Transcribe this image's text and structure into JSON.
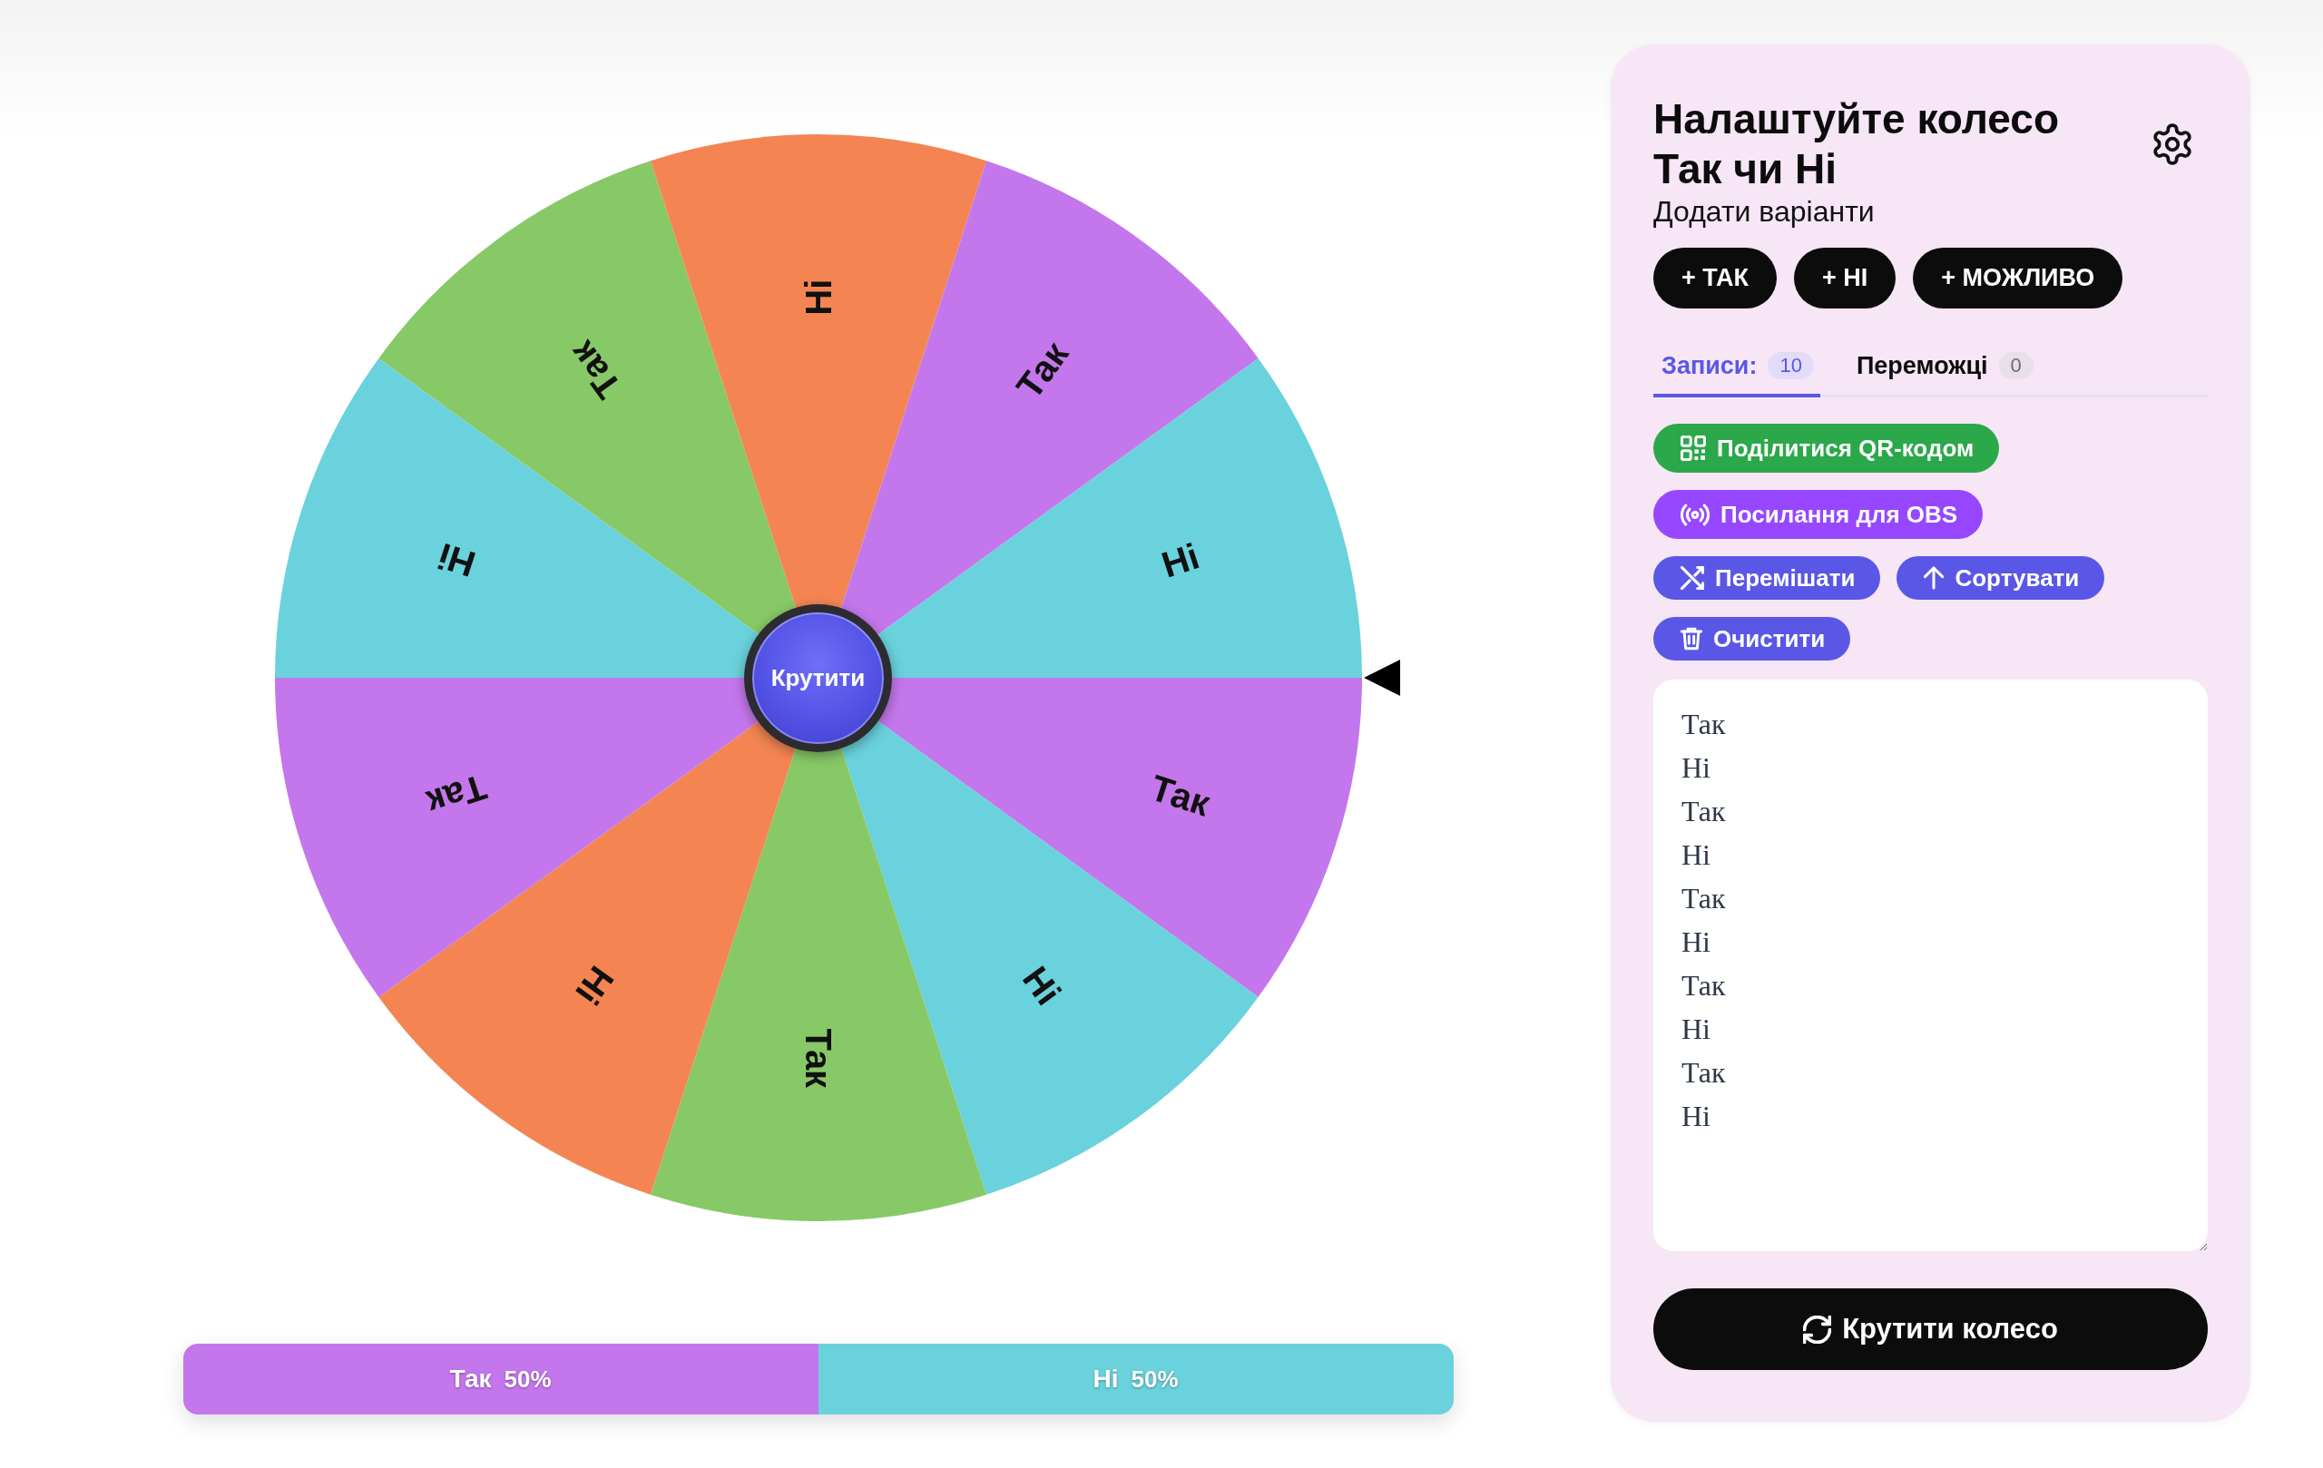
{
  "wheel": {
    "segments": [
      {
        "label": "Так",
        "color": "#c477ec"
      },
      {
        "label": "Ні",
        "color": "#6ad2dc"
      },
      {
        "label": "Так",
        "color": "#88c967"
      },
      {
        "label": "Ні",
        "color": "#f48553"
      },
      {
        "label": "Так",
        "color": "#c477ec"
      },
      {
        "label": "Ні",
        "color": "#6ad2dc"
      },
      {
        "label": "Так",
        "color": "#88c967"
      },
      {
        "label": "Ні",
        "color": "#f48553"
      },
      {
        "label": "Так",
        "color": "#c477ec"
      },
      {
        "label": "Ні",
        "color": "#6ad2dc"
      }
    ],
    "hub_button": "Крутити"
  },
  "distribution": {
    "segments": [
      {
        "label": "Так",
        "percent": "50%",
        "level": 0.5,
        "color": "#c477ec"
      },
      {
        "label": "Ні",
        "percent": "50%",
        "level": 0.5,
        "color": "#6ad2dc"
      }
    ]
  },
  "panel": {
    "title": "Налаштуйте колесо Так чи Ні",
    "subtitle": "Додати варіанти",
    "quick_add": [
      "+ ТАК",
      "+ НІ",
      "+ МОЖЛИВО"
    ],
    "tabs": [
      {
        "label": "Записи:",
        "count": "10",
        "selected": true
      },
      {
        "label": "Переможці",
        "count": "0",
        "selected": false
      }
    ],
    "actions": [
      {
        "kind": "qr",
        "label": "Поділитися QR-кодом",
        "color": "#2ba84a"
      },
      {
        "kind": "obs",
        "label": "Посилання для OBS",
        "color": "#9747ff"
      },
      {
        "kind": "shuffle",
        "label": "Перемішати",
        "color": "#5a57e6"
      },
      {
        "kind": "sort",
        "label": "Сортувати",
        "color": "#5a57e6"
      },
      {
        "kind": "clear",
        "label": "Очистити",
        "color": "#5a57e6"
      }
    ],
    "entries": [
      "Так",
      "Ні",
      "Так",
      "Ні",
      "Так",
      "Ні",
      "Так",
      "Ні",
      "Так",
      "Ні"
    ],
    "spin_button": "Крутити колесо"
  }
}
